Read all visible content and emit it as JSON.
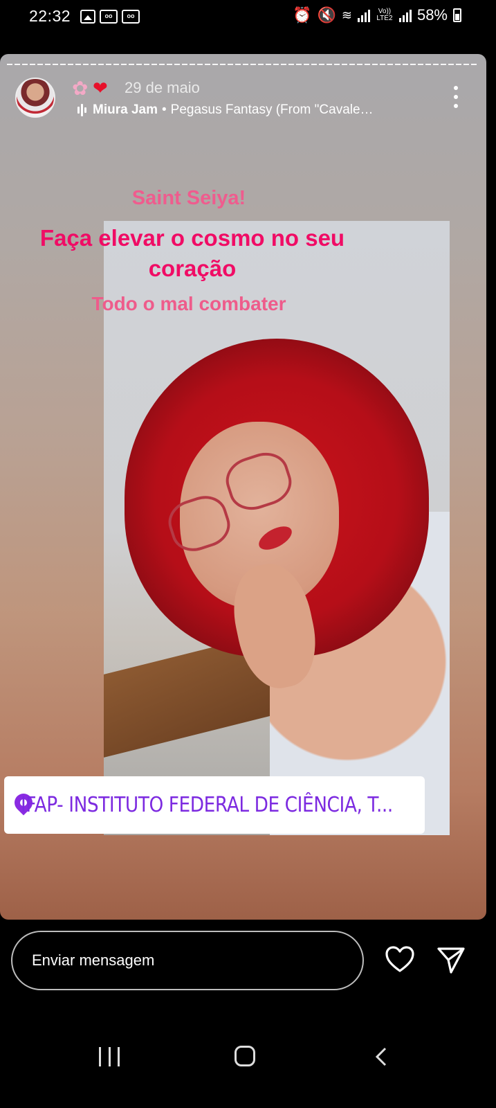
{
  "status_bar": {
    "time": "22:32",
    "volte": "Vo)) LTE2",
    "battery": "58%",
    "icons": [
      "image-icon",
      "voicemail-icon",
      "voicemail-icon",
      "alarm-icon",
      "mute-icon",
      "wifi-icon",
      "signal-icon",
      "signal-icon",
      "battery-icon"
    ]
  },
  "story": {
    "date": "29 de maio",
    "emojis": [
      "cherry-blossom",
      "red-heart"
    ],
    "music_artist": "Miura Jam",
    "music_separator": "•",
    "music_track": "Pegasus Fantasy (From \"Cavale…",
    "text_1": "Saint Seiya!",
    "text_2": "Faça elevar o cosmo no seu coração",
    "text_3": "Todo o mal combater",
    "location": "IFAP- INSTITUTO FEDERAL DE CIÊNCIA, T...",
    "colors": {
      "text_pink_light": "#ef5c8e",
      "text_pink_strong": "#f00c65",
      "location_purple": "#7c2ae0"
    }
  },
  "reply": {
    "placeholder": "Enviar mensagem"
  }
}
